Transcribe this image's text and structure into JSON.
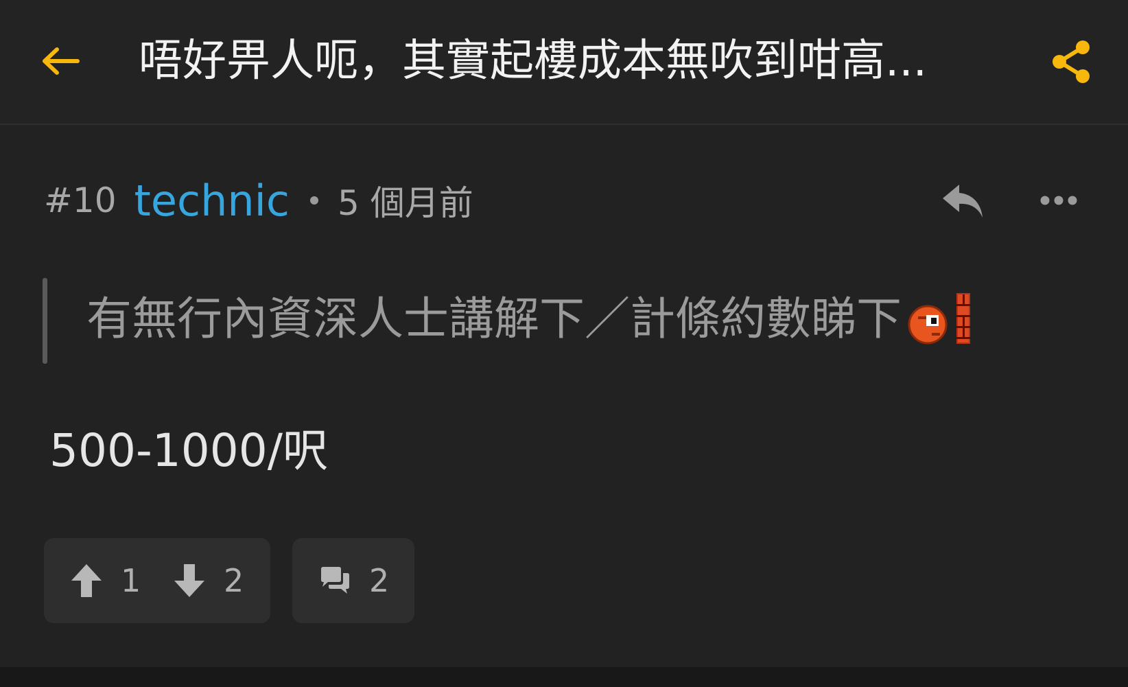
{
  "header": {
    "title": "唔好畀人呃，其實起樓成本無吹到咁高...",
    "back_icon": "arrow-left-icon",
    "share_icon": "share-icon",
    "accent_color": "#f7b70c"
  },
  "post": {
    "number": "#10",
    "username": "technic",
    "time": "5 個月前",
    "username_color": "#38a6de",
    "reply_icon": "reply-icon",
    "more_icon": "more-dots-icon",
    "quote": "有無行內資深人士講解下／計條約數睇下",
    "quote_emoji": "pixel-face-with-brick-emoji",
    "body": "500-1000/呎",
    "upvotes": "1",
    "downvotes": "2",
    "comments": "2"
  }
}
